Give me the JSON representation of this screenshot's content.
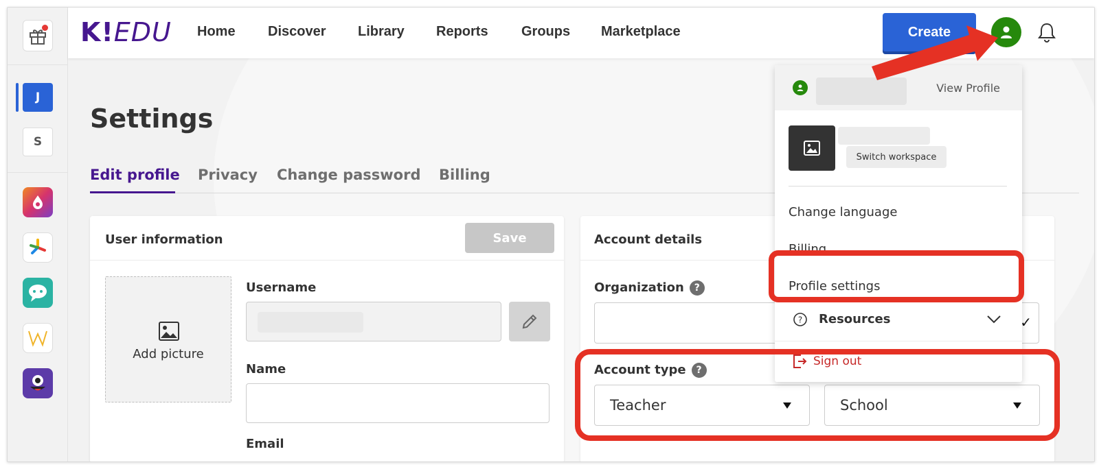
{
  "rail": {
    "workspaces": [
      {
        "letter": "J"
      },
      {
        "letter": "S"
      }
    ],
    "apps": [
      "drops-app-icon",
      "pinwheel-app-icon",
      "chat-app-icon",
      "w-app-icon",
      "monster-app-icon"
    ]
  },
  "nav": {
    "logo_k": "K!",
    "logo_edu": "EDU",
    "items": [
      "Home",
      "Discover",
      "Library",
      "Reports",
      "Groups",
      "Marketplace"
    ],
    "create_label": "Create"
  },
  "page": {
    "title": "Settings",
    "tabs": [
      "Edit profile",
      "Privacy",
      "Change password",
      "Billing"
    ],
    "active_tab": "Edit profile"
  },
  "user_info": {
    "title": "User information",
    "save_label": "Save",
    "add_picture": "Add picture",
    "username_label": "Username",
    "name_label": "Name",
    "email_label": "Email"
  },
  "account": {
    "title": "Account details",
    "organization_label": "Organization",
    "account_type_label": "Account type",
    "account_type_value": "Teacher",
    "workplace_value": "School",
    "checkmark": "✓"
  },
  "menu": {
    "view_profile": "View Profile",
    "switch_workspace": "Switch workspace",
    "change_language": "Change language",
    "billing": "Billing",
    "profile_settings": "Profile settings",
    "resources": "Resources",
    "sign_out": "Sign out"
  },
  "colors": {
    "brand": "#46178f",
    "create": "#2a63d6",
    "avatar": "#26890c",
    "annotation": "#e53124"
  }
}
